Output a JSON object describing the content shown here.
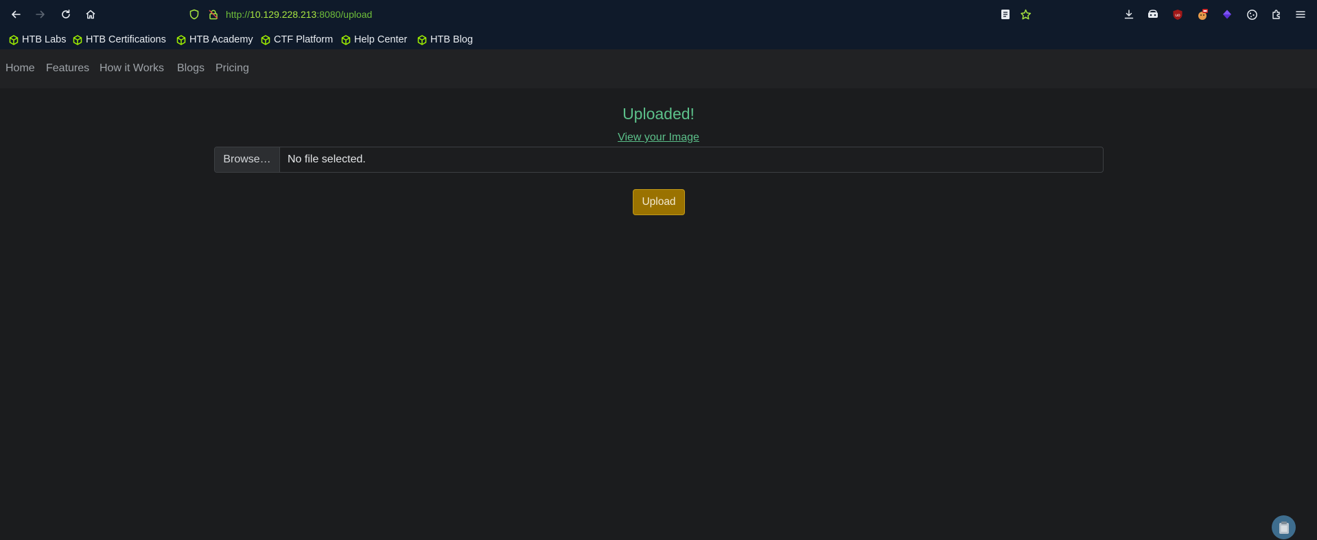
{
  "browser": {
    "url": {
      "scheme": "http://",
      "host": "10.129.228.213",
      "rest": ":8080/upload"
    },
    "nav_icons": [
      "back-arrow-icon",
      "forward-arrow-icon",
      "reload-icon",
      "home-icon"
    ],
    "toolbar_icons": [
      "downloads-icon",
      "container-tabs-icon",
      "ublock-origin-icon",
      "extension-icon",
      "extension-icon",
      "cookie-icon",
      "extensions-puzzle-icon",
      "hamburger-menu-icon"
    ],
    "bookmarks": [
      {
        "label": "HTB Labs"
      },
      {
        "label": "HTB Certifications"
      },
      {
        "label": "HTB Academy"
      },
      {
        "label": "CTF Platform"
      },
      {
        "label": "Help Center"
      },
      {
        "label": "HTB Blog"
      }
    ],
    "accent_color": "#a8e640"
  },
  "site": {
    "nav": [
      {
        "label": "Home"
      },
      {
        "label": "Features"
      },
      {
        "label": "How it Works"
      },
      {
        "label": "Blogs"
      },
      {
        "label": "Pricing"
      }
    ],
    "headline": "Uploaded!",
    "view_link": "View your Image",
    "file_input": {
      "browse_label": "Browse…",
      "status": "No file selected."
    },
    "upload_button": "Upload",
    "colors": {
      "success": "#5cc08a",
      "button": "#9a7200",
      "background": "#1b1c1e"
    }
  }
}
